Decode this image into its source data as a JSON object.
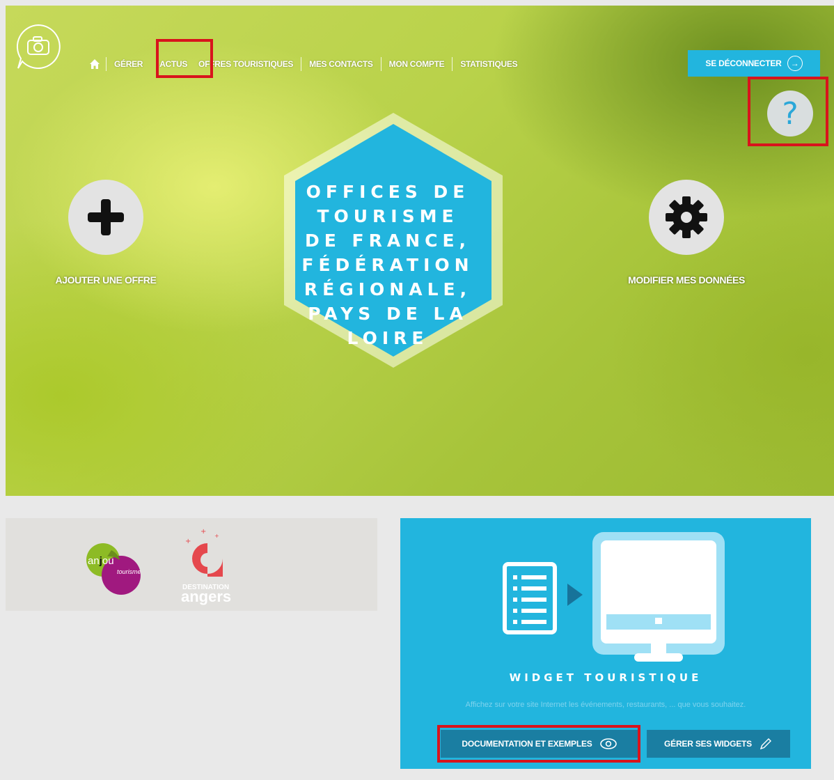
{
  "nav": {
    "items": [
      {
        "label": "GÉRER"
      },
      {
        "label": "ACTUS"
      },
      {
        "label": "OFFRES TOURISTIQUES"
      },
      {
        "label": "MES CONTACTS"
      },
      {
        "label": "MON COMPTE"
      },
      {
        "label": "STATISTIQUES"
      }
    ],
    "logout_label": "SE DÉCONNECTER",
    "help_label": "?"
  },
  "hero": {
    "title_lines": [
      "OFFICES DE",
      "TOURISME",
      "DE FRANCE,",
      "FÉDÉRATION",
      "RÉGIONALE,",
      "PAYS DE LA",
      "LOIRE"
    ],
    "add_offer_label": "AJOUTER UNE OFFRE",
    "edit_data_label": "MODIFIER MES DONNÉES"
  },
  "partners": {
    "anjou_logo_text": [
      "an",
      "j",
      "ou",
      "tourisme"
    ],
    "angers_logo_text": [
      "DESTINATION",
      "angers"
    ]
  },
  "widget": {
    "title": "WIDGET TOURISTIQUE",
    "description": "Affichez sur votre site Internet les événements, restaurants, ... que vous souhaitez.",
    "doc_button_label": "DOCUMENTATION ET EXEMPLES",
    "manage_button_label": "GÉRER SES WIDGETS"
  },
  "colors": {
    "accent_blue": "#22b5de",
    "button_dark_blue": "#1a7ea2",
    "highlight_red": "#d8141c",
    "hero_green": "#b9d24a"
  },
  "icons": [
    "camera-chat-logo-icon",
    "home-icon",
    "arrow-circle-right-icon",
    "help-question-icon",
    "plus-icon",
    "gear-icon",
    "document-list-icon",
    "play-arrow-icon",
    "monitor-icon",
    "eye-icon",
    "pencil-icon"
  ]
}
